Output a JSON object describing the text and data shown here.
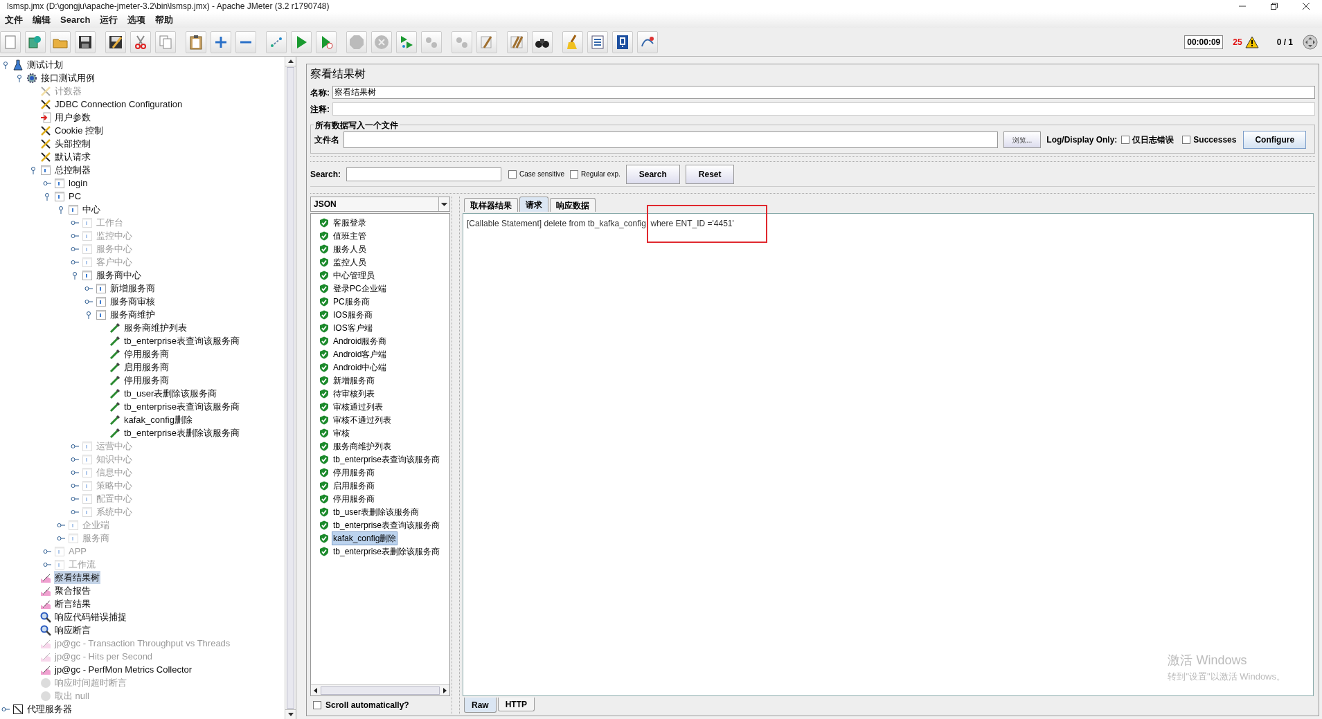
{
  "window": {
    "title": "lsmsp.jmx (D:\\gongju\\apache-jmeter-3.2\\bin\\lsmsp.jmx) - Apache JMeter (3.2 r1790748)"
  },
  "menu": [
    "文件",
    "编辑",
    "Search",
    "运行",
    "选项",
    "帮助"
  ],
  "status": {
    "elapsed": "00:00:09",
    "warnings": "25",
    "threads": "0 / 1"
  },
  "tree": [
    {
      "label": "测试计划",
      "kind": "plan",
      "disabled": false,
      "selected": false,
      "expanded": true,
      "children": [
        {
          "label": "接口测试用例",
          "kind": "thread-group",
          "disabled": false,
          "selected": false,
          "expanded": true,
          "children": [
            {
              "label": "计数器",
              "kind": "config",
              "disabled": true,
              "selected": false
            },
            {
              "label": "JDBC Connection Configuration",
              "kind": "config",
              "disabled": false,
              "selected": false
            },
            {
              "label": "用户参数",
              "kind": "preprocessor",
              "disabled": false,
              "selected": false
            },
            {
              "label": "Cookie 控制",
              "kind": "config",
              "disabled": false,
              "selected": false
            },
            {
              "label": "头部控制",
              "kind": "config",
              "disabled": false,
              "selected": false
            },
            {
              "label": "默认请求",
              "kind": "config",
              "disabled": false,
              "selected": false
            },
            {
              "label": "总控制器",
              "kind": "controller",
              "disabled": false,
              "selected": false,
              "expanded": true,
              "children": [
                {
                  "label": "login",
                  "kind": "controller",
                  "disabled": false,
                  "selected": false,
                  "expanded": false
                },
                {
                  "label": "PC",
                  "kind": "controller",
                  "disabled": false,
                  "selected": false,
                  "expanded": true,
                  "children": [
                    {
                      "label": "中心",
                      "kind": "controller",
                      "disabled": false,
                      "selected": false,
                      "expanded": true,
                      "children": [
                        {
                          "label": "工作台",
                          "kind": "controller",
                          "disabled": true,
                          "selected": false,
                          "expanded": false
                        },
                        {
                          "label": "监控中心",
                          "kind": "controller",
                          "disabled": true,
                          "selected": false,
                          "expanded": false
                        },
                        {
                          "label": "服务中心",
                          "kind": "controller",
                          "disabled": true,
                          "selected": false,
                          "expanded": false
                        },
                        {
                          "label": "客户中心",
                          "kind": "controller",
                          "disabled": true,
                          "selected": false,
                          "expanded": false
                        },
                        {
                          "label": "服务商中心",
                          "kind": "controller",
                          "disabled": false,
                          "selected": false,
                          "expanded": true,
                          "children": [
                            {
                              "label": "新增服务商",
                              "kind": "controller",
                              "disabled": false,
                              "selected": false,
                              "expanded": false
                            },
                            {
                              "label": "服务商审核",
                              "kind": "controller",
                              "disabled": false,
                              "selected": false,
                              "expanded": false
                            },
                            {
                              "label": "服务商维护",
                              "kind": "controller",
                              "disabled": false,
                              "selected": false,
                              "expanded": true,
                              "children": [
                                {
                                  "label": "服务商维护列表",
                                  "kind": "sampler",
                                  "disabled": false,
                                  "selected": false
                                },
                                {
                                  "label": "tb_enterprise表查询该服务商",
                                  "kind": "sampler",
                                  "disabled": false,
                                  "selected": false
                                },
                                {
                                  "label": "停用服务商",
                                  "kind": "sampler",
                                  "disabled": false,
                                  "selected": false
                                },
                                {
                                  "label": "启用服务商",
                                  "kind": "sampler",
                                  "disabled": false,
                                  "selected": false
                                },
                                {
                                  "label": "停用服务商",
                                  "kind": "sampler",
                                  "disabled": false,
                                  "selected": false
                                },
                                {
                                  "label": "tb_user表删除该服务商",
                                  "kind": "sampler",
                                  "disabled": false,
                                  "selected": false
                                },
                                {
                                  "label": "tb_enterprise表查询该服务商",
                                  "kind": "sampler",
                                  "disabled": false,
                                  "selected": false
                                },
                                {
                                  "label": "kafak_config删除",
                                  "kind": "sampler",
                                  "disabled": false,
                                  "selected": false
                                },
                                {
                                  "label": "tb_enterprise表删除该服务商",
                                  "kind": "sampler",
                                  "disabled": false,
                                  "selected": false
                                }
                              ]
                            }
                          ]
                        },
                        {
                          "label": "运营中心",
                          "kind": "controller",
                          "disabled": true,
                          "selected": false,
                          "expanded": false
                        },
                        {
                          "label": "知识中心",
                          "kind": "controller",
                          "disabled": true,
                          "selected": false,
                          "expanded": false
                        },
                        {
                          "label": "信息中心",
                          "kind": "controller",
                          "disabled": true,
                          "selected": false,
                          "expanded": false
                        },
                        {
                          "label": "策略中心",
                          "kind": "controller",
                          "disabled": true,
                          "selected": false,
                          "expanded": false
                        },
                        {
                          "label": "配置中心",
                          "kind": "controller",
                          "disabled": true,
                          "selected": false,
                          "expanded": false
                        },
                        {
                          "label": "系统中心",
                          "kind": "controller",
                          "disabled": true,
                          "selected": false,
                          "expanded": false
                        }
                      ]
                    },
                    {
                      "label": "企业端",
                      "kind": "controller",
                      "disabled": true,
                      "selected": false,
                      "expanded": false
                    },
                    {
                      "label": "服务商",
                      "kind": "controller",
                      "disabled": true,
                      "selected": false,
                      "expanded": false
                    }
                  ]
                },
                {
                  "label": "APP",
                  "kind": "controller",
                  "disabled": true,
                  "selected": false,
                  "expanded": false
                },
                {
                  "label": "工作流",
                  "kind": "controller",
                  "disabled": true,
                  "selected": false,
                  "expanded": false
                }
              ]
            },
            {
              "label": "察看结果树",
              "kind": "listener",
              "disabled": false,
              "selected": true
            },
            {
              "label": "聚合报告",
              "kind": "listener",
              "disabled": false,
              "selected": false
            },
            {
              "label": "断言结果",
              "kind": "listener",
              "disabled": false,
              "selected": false
            },
            {
              "label": "响应代码错误捕捉",
              "kind": "assertion",
              "disabled": false,
              "selected": false
            },
            {
              "label": "响应断言",
              "kind": "assertion",
              "disabled": false,
              "selected": false
            },
            {
              "label": "jp@gc - Transaction Throughput vs Threads",
              "kind": "listener",
              "disabled": true,
              "selected": false
            },
            {
              "label": "jp@gc - Hits per Second",
              "kind": "listener",
              "disabled": true,
              "selected": false
            },
            {
              "label": "jp@gc - PerfMon Metrics Collector",
              "kind": "listener",
              "disabled": false,
              "selected": false
            },
            {
              "label": "响应时间超时断言",
              "kind": "blob",
              "disabled": true,
              "selected": false
            },
            {
              "label": "取出 null",
              "kind": "blob",
              "disabled": true,
              "selected": false
            }
          ]
        }
      ]
    },
    {
      "label": "代理服务器",
      "kind": "workbench",
      "disabled": false,
      "selected": false,
      "expanded": false
    }
  ],
  "panel": {
    "title": "察看结果树",
    "name_label": "名称:",
    "name_value": "察看结果树",
    "comment_label": "注释:",
    "file_group": "所有数据写入一个文件",
    "file_label": "文件名",
    "browse": "浏览...",
    "log_label": "Log/Display Only:",
    "errors_only": {
      "label": "仅日志错误",
      "checked": false
    },
    "successes": {
      "label": "Successes",
      "checked": false
    },
    "configure": "Configure"
  },
  "search": {
    "label": "Search:",
    "case_sensitive": {
      "label": "Case sensitive",
      "checked": false
    },
    "regex": {
      "label": "Regular exp.",
      "checked": false
    },
    "search_button": "Search",
    "reset_button": "Reset"
  },
  "renderer": "JSON",
  "results": [
    {
      "label": "客服登录",
      "selected": false
    },
    {
      "label": "值班主管",
      "selected": false
    },
    {
      "label": "服务人员",
      "selected": false
    },
    {
      "label": "监控人员",
      "selected": false
    },
    {
      "label": "中心管理员",
      "selected": false
    },
    {
      "label": "登录PC企业端",
      "selected": false
    },
    {
      "label": "PC服务商",
      "selected": false
    },
    {
      "label": "IOS服务商",
      "selected": false
    },
    {
      "label": "IOS客户端",
      "selected": false
    },
    {
      "label": "Android服务商",
      "selected": false
    },
    {
      "label": "Android客户端",
      "selected": false
    },
    {
      "label": "Android中心端",
      "selected": false
    },
    {
      "label": "新增服务商",
      "selected": false
    },
    {
      "label": "待审核列表",
      "selected": false
    },
    {
      "label": "审核通过列表",
      "selected": false
    },
    {
      "label": "审核不通过列表",
      "selected": false
    },
    {
      "label": "审核",
      "selected": false
    },
    {
      "label": "服务商维护列表",
      "selected": false
    },
    {
      "label": "tb_enterprise表查询该服务商",
      "selected": false
    },
    {
      "label": "停用服务商",
      "selected": false
    },
    {
      "label": "启用服务商",
      "selected": false
    },
    {
      "label": "停用服务商",
      "selected": false
    },
    {
      "label": "tb_user表删除该服务商",
      "selected": false
    },
    {
      "label": "tb_enterprise表查询该服务商",
      "selected": false
    },
    {
      "label": "kafak_config删除",
      "selected": true
    },
    {
      "label": "tb_enterprise表删除该服务商",
      "selected": false
    }
  ],
  "scroll_auto": {
    "label": "Scroll automatically?",
    "checked": false
  },
  "tabs": [
    {
      "label": "取样器结果",
      "selected": false
    },
    {
      "label": "请求",
      "selected": true
    },
    {
      "label": "响应数据",
      "selected": false
    }
  ],
  "request_text": "[Callable Statement] delete from tb_kafka_config  where ENT_ID ='4451'",
  "bottom_tabs": [
    {
      "label": "Raw",
      "selected": true
    },
    {
      "label": "HTTP",
      "selected": false
    }
  ],
  "activation": {
    "title": "激活 Windows",
    "hint": "转到\"设置\"以激活 Windows。"
  }
}
